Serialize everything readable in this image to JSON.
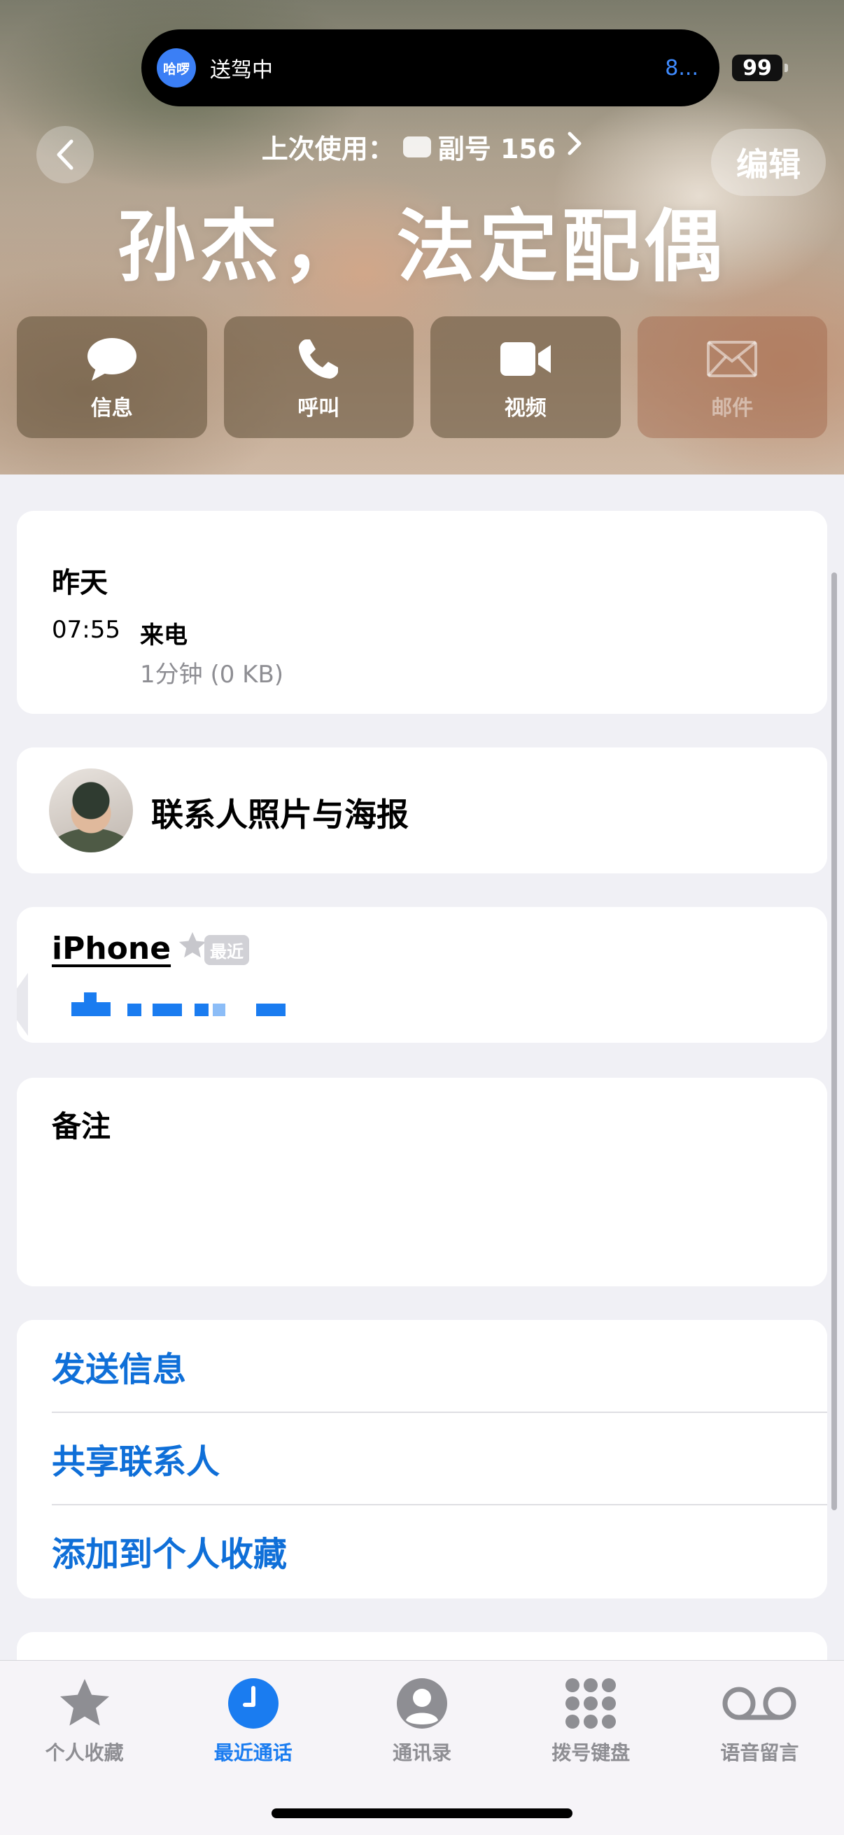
{
  "status": {
    "live_activity_logo": "哈啰",
    "live_activity_title": "送驾中",
    "live_activity_eta": "8...",
    "battery_level": "99"
  },
  "header": {
    "last_used_label": "上次使用：",
    "last_used_line": "副号 156",
    "edit_label": "编辑",
    "contact_name": "孙杰， 法定配偶"
  },
  "actions": [
    {
      "label": "信息",
      "icon": "message-bubble-icon",
      "enabled": true
    },
    {
      "label": "呼叫",
      "icon": "phone-icon",
      "enabled": true
    },
    {
      "label": "视频",
      "icon": "video-camera-icon",
      "enabled": true
    },
    {
      "label": "邮件",
      "icon": "envelope-icon",
      "enabled": false
    }
  ],
  "recent_call": {
    "date": "昨天",
    "time": "07:55",
    "type": "来电",
    "duration": "1分钟 (0 KB)"
  },
  "poster": {
    "label": "联系人照片与海报"
  },
  "phone": {
    "label": "iPhone",
    "badge": "最近",
    "number_redacted": true
  },
  "notes": {
    "label": "备注"
  },
  "links": {
    "send_message": "发送信息",
    "share_contact": "共享联系人",
    "add_favorite": "添加到个人收藏"
  },
  "tabbar": [
    {
      "label": "个人收藏",
      "icon": "star-icon",
      "active": false
    },
    {
      "label": "最近通话",
      "icon": "clock-icon",
      "active": true
    },
    {
      "label": "通讯录",
      "icon": "person-circle-icon",
      "active": false
    },
    {
      "label": "拨号键盘",
      "icon": "keypad-icon",
      "active": false
    },
    {
      "label": "语音留言",
      "icon": "voicemail-icon",
      "active": false
    }
  ],
  "colors": {
    "accent": "#1a7cf0",
    "link": "#0f6fd8",
    "background": "#f0f0f5",
    "secondary_text": "#8e8e93"
  }
}
